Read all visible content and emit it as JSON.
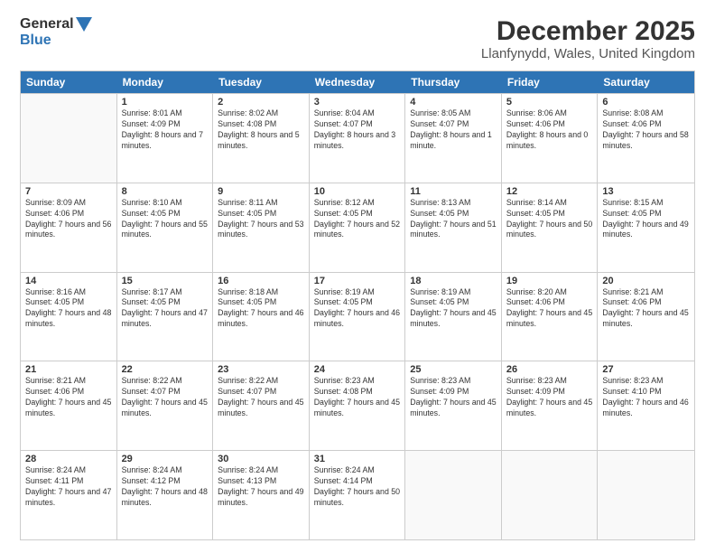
{
  "logo": {
    "general": "General",
    "blue": "Blue",
    "tagline": "GeneralBlue"
  },
  "title": "December 2025",
  "subtitle": "Llanfynydd, Wales, United Kingdom",
  "weekdays": [
    "Sunday",
    "Monday",
    "Tuesday",
    "Wednesday",
    "Thursday",
    "Friday",
    "Saturday"
  ],
  "weeks": [
    [
      {
        "day": null
      },
      {
        "day": "1",
        "sunrise": "8:01 AM",
        "sunset": "4:09 PM",
        "daylight": "8 hours and 7 minutes."
      },
      {
        "day": "2",
        "sunrise": "8:02 AM",
        "sunset": "4:08 PM",
        "daylight": "8 hours and 5 minutes."
      },
      {
        "day": "3",
        "sunrise": "8:04 AM",
        "sunset": "4:07 PM",
        "daylight": "8 hours and 3 minutes."
      },
      {
        "day": "4",
        "sunrise": "8:05 AM",
        "sunset": "4:07 PM",
        "daylight": "8 hours and 1 minute."
      },
      {
        "day": "5",
        "sunrise": "8:06 AM",
        "sunset": "4:06 PM",
        "daylight": "8 hours and 0 minutes."
      },
      {
        "day": "6",
        "sunrise": "8:08 AM",
        "sunset": "4:06 PM",
        "daylight": "7 hours and 58 minutes."
      }
    ],
    [
      {
        "day": "7",
        "sunrise": "8:09 AM",
        "sunset": "4:06 PM",
        "daylight": "7 hours and 56 minutes."
      },
      {
        "day": "8",
        "sunrise": "8:10 AM",
        "sunset": "4:05 PM",
        "daylight": "7 hours and 55 minutes."
      },
      {
        "day": "9",
        "sunrise": "8:11 AM",
        "sunset": "4:05 PM",
        "daylight": "7 hours and 53 minutes."
      },
      {
        "day": "10",
        "sunrise": "8:12 AM",
        "sunset": "4:05 PM",
        "daylight": "7 hours and 52 minutes."
      },
      {
        "day": "11",
        "sunrise": "8:13 AM",
        "sunset": "4:05 PM",
        "daylight": "7 hours and 51 minutes."
      },
      {
        "day": "12",
        "sunrise": "8:14 AM",
        "sunset": "4:05 PM",
        "daylight": "7 hours and 50 minutes."
      },
      {
        "day": "13",
        "sunrise": "8:15 AM",
        "sunset": "4:05 PM",
        "daylight": "7 hours and 49 minutes."
      }
    ],
    [
      {
        "day": "14",
        "sunrise": "8:16 AM",
        "sunset": "4:05 PM",
        "daylight": "7 hours and 48 minutes."
      },
      {
        "day": "15",
        "sunrise": "8:17 AM",
        "sunset": "4:05 PM",
        "daylight": "7 hours and 47 minutes."
      },
      {
        "day": "16",
        "sunrise": "8:18 AM",
        "sunset": "4:05 PM",
        "daylight": "7 hours and 46 minutes."
      },
      {
        "day": "17",
        "sunrise": "8:19 AM",
        "sunset": "4:05 PM",
        "daylight": "7 hours and 46 minutes."
      },
      {
        "day": "18",
        "sunrise": "8:19 AM",
        "sunset": "4:05 PM",
        "daylight": "7 hours and 45 minutes."
      },
      {
        "day": "19",
        "sunrise": "8:20 AM",
        "sunset": "4:06 PM",
        "daylight": "7 hours and 45 minutes."
      },
      {
        "day": "20",
        "sunrise": "8:21 AM",
        "sunset": "4:06 PM",
        "daylight": "7 hours and 45 minutes."
      }
    ],
    [
      {
        "day": "21",
        "sunrise": "8:21 AM",
        "sunset": "4:06 PM",
        "daylight": "7 hours and 45 minutes."
      },
      {
        "day": "22",
        "sunrise": "8:22 AM",
        "sunset": "4:07 PM",
        "daylight": "7 hours and 45 minutes."
      },
      {
        "day": "23",
        "sunrise": "8:22 AM",
        "sunset": "4:07 PM",
        "daylight": "7 hours and 45 minutes."
      },
      {
        "day": "24",
        "sunrise": "8:23 AM",
        "sunset": "4:08 PM",
        "daylight": "7 hours and 45 minutes."
      },
      {
        "day": "25",
        "sunrise": "8:23 AM",
        "sunset": "4:09 PM",
        "daylight": "7 hours and 45 minutes."
      },
      {
        "day": "26",
        "sunrise": "8:23 AM",
        "sunset": "4:09 PM",
        "daylight": "7 hours and 45 minutes."
      },
      {
        "day": "27",
        "sunrise": "8:23 AM",
        "sunset": "4:10 PM",
        "daylight": "7 hours and 46 minutes."
      }
    ],
    [
      {
        "day": "28",
        "sunrise": "8:24 AM",
        "sunset": "4:11 PM",
        "daylight": "7 hours and 47 minutes."
      },
      {
        "day": "29",
        "sunrise": "8:24 AM",
        "sunset": "4:12 PM",
        "daylight": "7 hours and 48 minutes."
      },
      {
        "day": "30",
        "sunrise": "8:24 AM",
        "sunset": "4:13 PM",
        "daylight": "7 hours and 49 minutes."
      },
      {
        "day": "31",
        "sunrise": "8:24 AM",
        "sunset": "4:14 PM",
        "daylight": "7 hours and 50 minutes."
      },
      {
        "day": null
      },
      {
        "day": null
      },
      {
        "day": null
      }
    ]
  ]
}
